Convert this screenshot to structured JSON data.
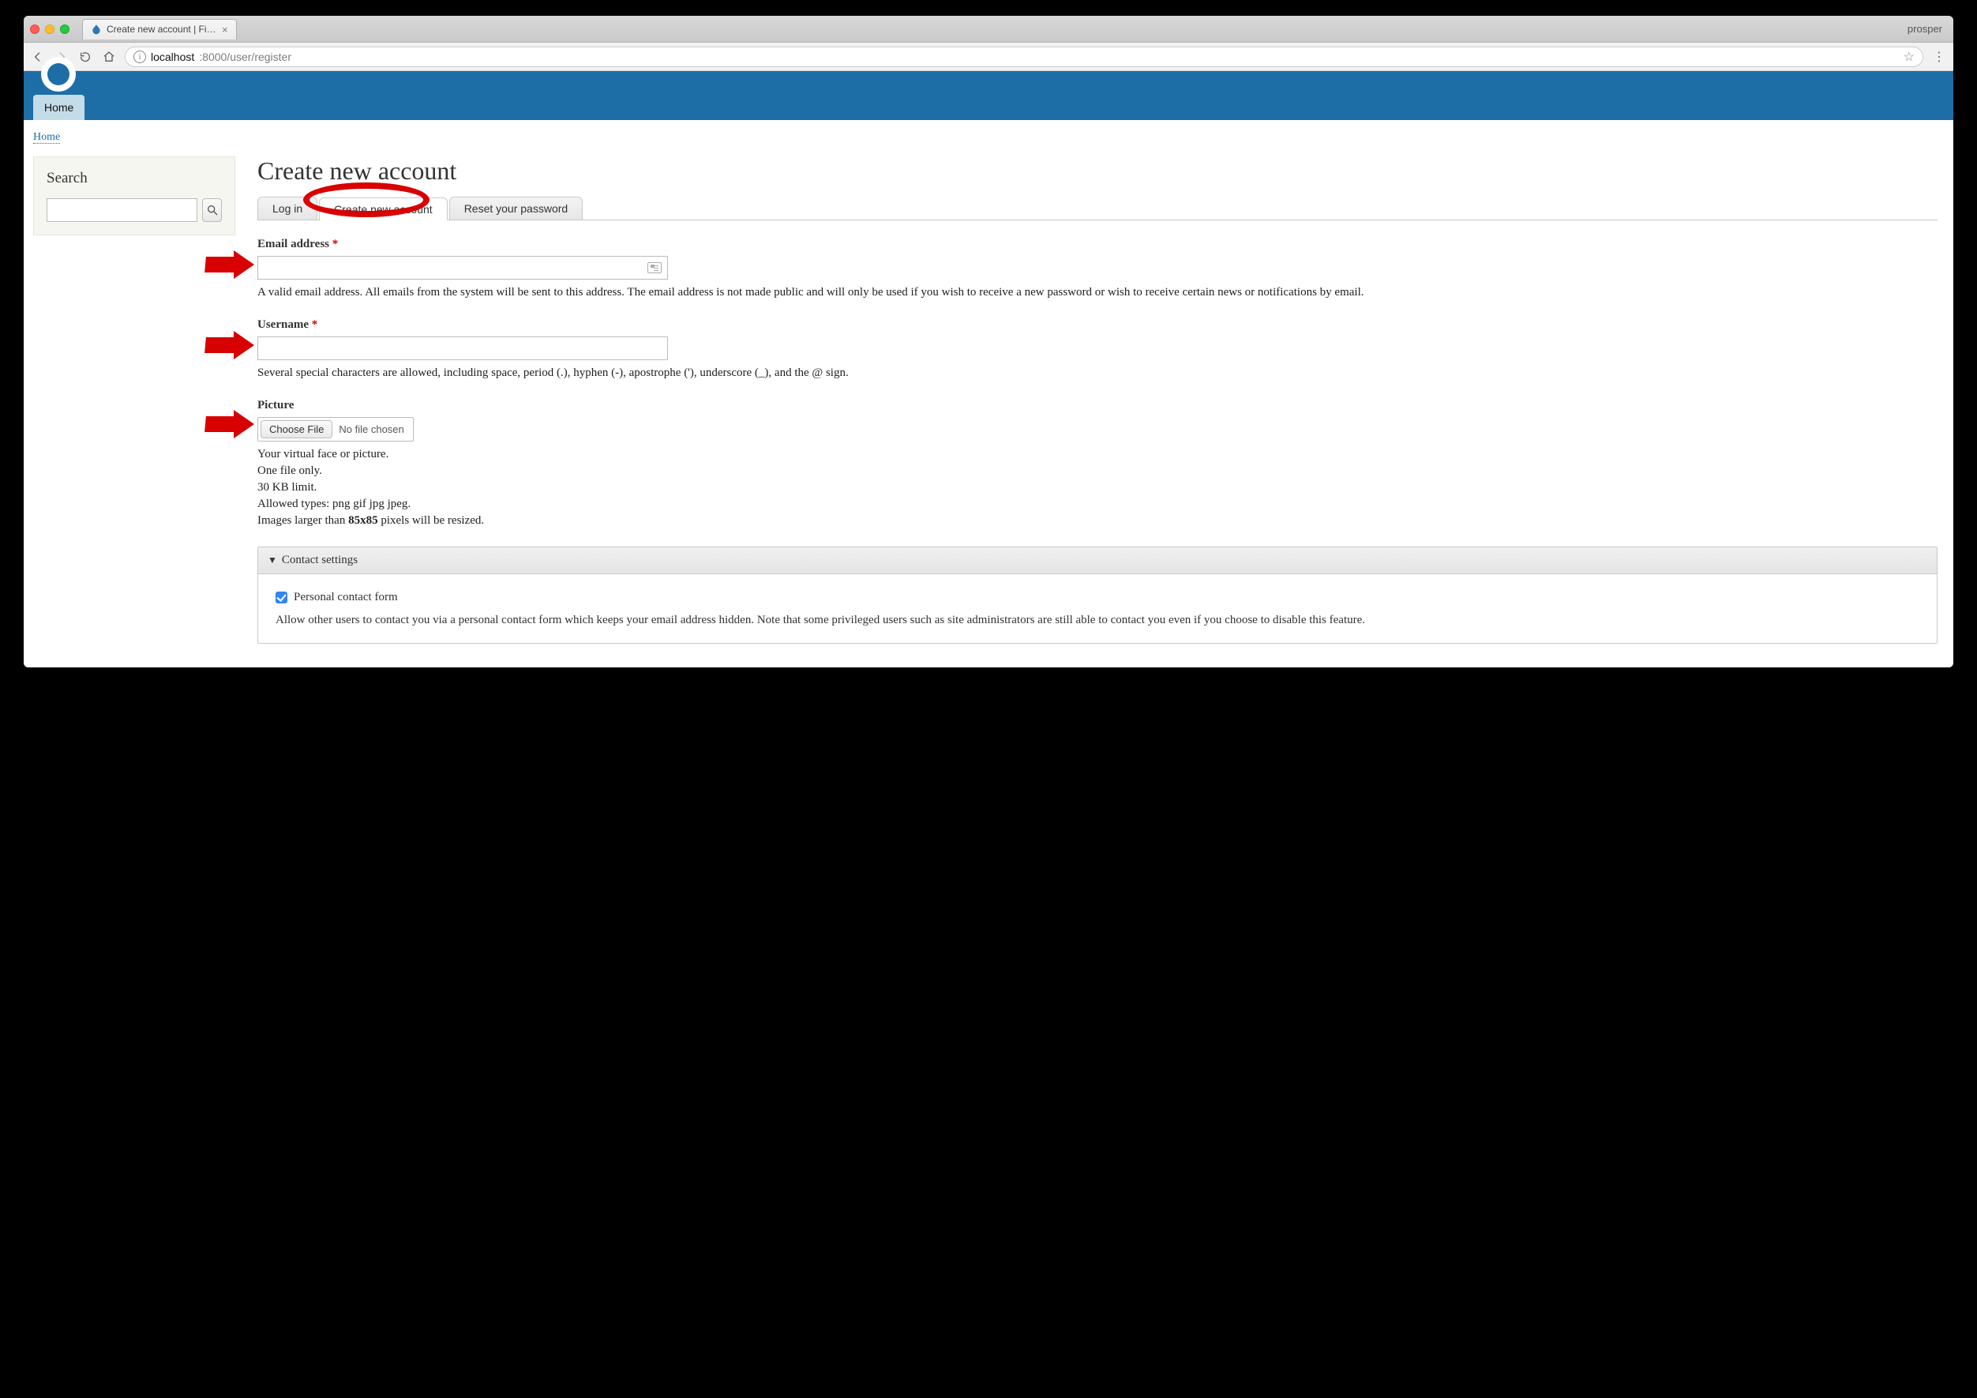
{
  "browser": {
    "profile": "prosper",
    "tab_title": "Create new account | First Dru",
    "url_host": "localhost",
    "url_port_path": ":8000/user/register"
  },
  "nav": {
    "home": "Home",
    "breadcrumb_home": "Home"
  },
  "sidebar": {
    "search_title": "Search"
  },
  "page": {
    "title": "Create new account"
  },
  "tabs": {
    "login": "Log in",
    "create": "Create new account",
    "reset": "Reset your password"
  },
  "form": {
    "email_label": "Email address",
    "email_help": "A valid email address. All emails from the system will be sent to this address. The email address is not made public and will only be used if you wish to receive a new password or wish to receive certain news or notifications by email.",
    "username_label": "Username",
    "username_help": "Several special characters are allowed, including space, period (.), hyphen (-), apostrophe ('), underscore (_), and the @ sign.",
    "picture_label": "Picture",
    "choose_file": "Choose File",
    "file_status": "No file chosen",
    "picture_help_1": "Your virtual face or picture.",
    "picture_help_2": "One file only.",
    "picture_help_3": "30 KB limit.",
    "picture_help_4": "Allowed types: png gif jpg jpeg.",
    "picture_help_5a": "Images larger than ",
    "picture_help_5b": "85x85",
    "picture_help_5c": " pixels will be resized.",
    "contact_settings": "Contact settings",
    "personal_contact_label": "Personal contact form",
    "personal_contact_help": "Allow other users to contact you via a personal contact form which keeps your email address hidden. Note that some privileged users such as site administrators are still able to contact you even if you choose to disable this feature."
  }
}
